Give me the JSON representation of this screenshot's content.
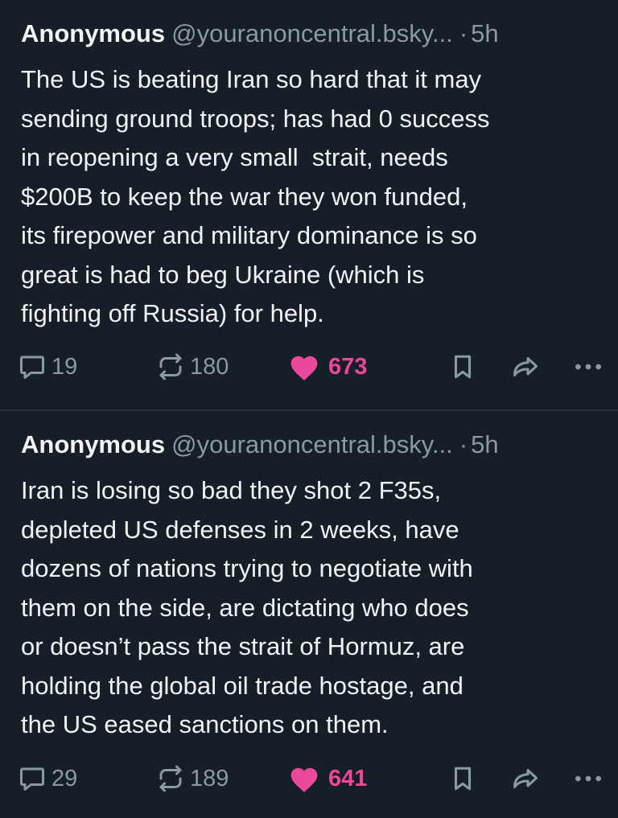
{
  "posts": [
    {
      "author": "Anonymous",
      "handle": "@youranoncentral.bsky...",
      "separator": "·",
      "time": "5h",
      "text": "The US is beating Iran so hard that it may sending ground troops; has had 0 success in reopening a very small  strait, needs $200B to keep the war they won funded, its firepower and military dominance is so great is had to beg Ukraine (which is fighting off Russia) for help.",
      "lines": [
        "The US is beating Iran so hard that it may",
        "sending ground troops; has had 0 success",
        "in reopening a very small  strait, needs",
        "$200B to keep the war they won funded,",
        "its firepower and military dominance is so",
        "great is had to beg Ukraine (which is",
        "fighting off Russia) for help."
      ],
      "replies": "19",
      "reposts": "180",
      "likes": "673"
    },
    {
      "author": "Anonymous",
      "handle": "@youranoncentral.bsky...",
      "separator": "·",
      "time": "5h",
      "lines": [
        "Iran is losing so bad they shot 2 F35s,",
        "depleted US defenses in 2 weeks, have",
        "dozens of nations trying to negotiate with",
        "them on the side, are dictating who does",
        "or doesn’t pass the strait of Hormuz, are",
        "holding the global oil trade hostage, and",
        "the US eased sanctions on them."
      ],
      "replies": "29",
      "reposts": "189",
      "likes": "641"
    }
  ],
  "icons": {
    "reply": "reply-icon",
    "repost": "repost-icon",
    "like": "heart-icon",
    "bookmark": "bookmark-icon",
    "share": "share-icon",
    "more": "more-icon"
  },
  "colors": {
    "background": "#161e27",
    "text": "#f1f3f5",
    "muted": "#8b98a5",
    "like": "#ec4899",
    "divider": "#262f3a"
  }
}
